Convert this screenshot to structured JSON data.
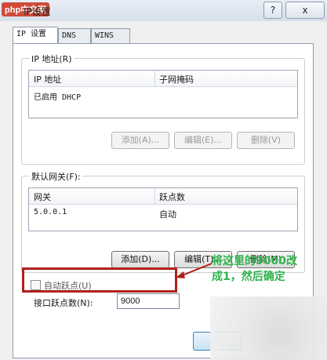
{
  "window": {
    "title": "IP设置",
    "help_label": "?",
    "close_label": "x",
    "watermark": "php中文网"
  },
  "tabs": [
    {
      "label": "IP 设置",
      "active": true
    },
    {
      "label": "DNS",
      "active": false
    },
    {
      "label": "WINS",
      "active": false
    }
  ],
  "ip_group": {
    "legend": "IP 地址(R)",
    "headers": [
      "IP 地址",
      "子网掩码"
    ],
    "rows": [
      [
        "已启用 DHCP",
        ""
      ]
    ],
    "buttons": {
      "add": "添加(A)...",
      "edit": "编辑(E)...",
      "remove": "删除(V)"
    }
  },
  "gateway_group": {
    "legend": "默认网关(F):",
    "headers": [
      "网关",
      "跃点数"
    ],
    "rows": [
      [
        "5.0.0.1",
        "自动"
      ]
    ],
    "buttons": {
      "add": "添加(D)...",
      "edit": "编辑(T)...",
      "remove": "删除(M)"
    }
  },
  "auto_metric": {
    "label": "自动跃点(U)",
    "checked": false
  },
  "interface_metric": {
    "label": "接口跃点数(N):",
    "value": "9000"
  },
  "annotation": {
    "line1": "将这里的9000改",
    "line2": "成1，然后确定",
    "color": "#2fb34b"
  },
  "colors": {
    "highlight": "#b0201a"
  }
}
